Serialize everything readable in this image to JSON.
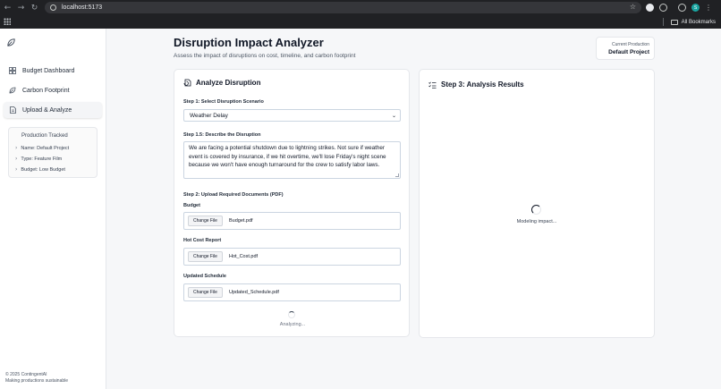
{
  "browser": {
    "url": "localhost:5173",
    "bookmarks_label": "All Bookmarks",
    "profile_initial": "S"
  },
  "sidebar": {
    "items": [
      {
        "label": "Budget Dashboard",
        "icon": "grid-icon"
      },
      {
        "label": "Carbon Footprint",
        "icon": "leaf-icon"
      },
      {
        "label": "Upload & Analyze",
        "icon": "document-icon",
        "active": true
      }
    ],
    "production_tracked": {
      "title": "Production Tracked",
      "rows": [
        "Name: Default Project",
        "Type: Feature Film",
        "Budget: Low Budget"
      ]
    },
    "footer": {
      "copyright": "© 2025 ContingentAI",
      "tagline": "Making productions sustainable"
    }
  },
  "header": {
    "title": "Disruption Impact Analyzer",
    "subtitle": "Assess the impact of disruptions on cost, timeline, and carbon footprint",
    "current_production_label": "Current Production",
    "current_production_value": "Default Project"
  },
  "analyze": {
    "title": "Analyze Disruption",
    "step1_label": "Step 1: Select Disruption Scenario",
    "scenario_value": "Weather Delay",
    "step15_label": "Step 1.5: Describe the Disruption",
    "description": "We are facing a potential shutdown due to lightning strikes. Not sure if weather event is covered by insurance, if we hit overtime, we'll lose Friday's night scene because we won't have enough turnaround for the crew to satisfy labor laws.",
    "step2_label": "Step 2: Upload Required Documents (PDF)",
    "files": [
      {
        "label": "Budget",
        "button": "Change File",
        "filename": "Budget.pdf"
      },
      {
        "label": "Hot Cost Report",
        "button": "Change File",
        "filename": "Hot_Cost.pdf"
      },
      {
        "label": "Updated Schedule",
        "button": "Change File",
        "filename": "Updated_Schedule.pdf"
      }
    ],
    "status": "Analyzing..."
  },
  "results": {
    "title": "Step 3: Analysis Results",
    "status": "Modeling impact..."
  }
}
